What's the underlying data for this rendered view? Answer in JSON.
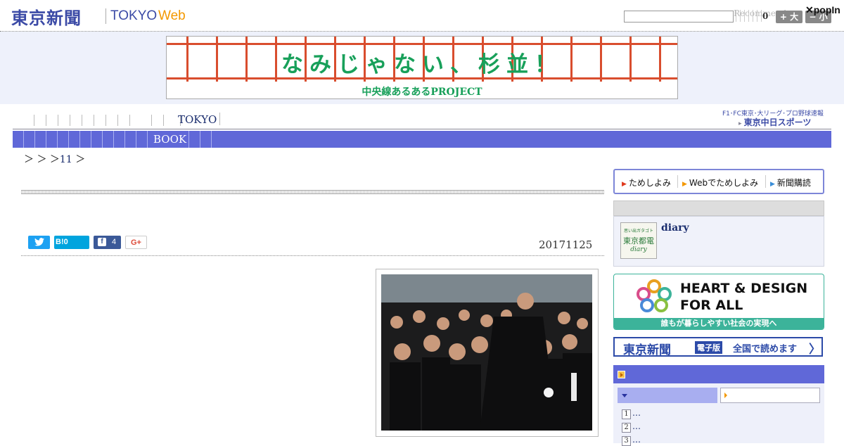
{
  "header": {
    "logo_jp": "東京新聞",
    "logo_tokyo": "TOKYO",
    "logo_web": "Web",
    "search_placeholder": "",
    "popin_label": "Recommend",
    "count": "0",
    "font_big_label": "+ 大",
    "font_small_label": "− 小",
    "popin_logo": "popIn"
  },
  "ad_banner": {
    "title": "なみじゃない、杉並！",
    "subtitle": "中央線あるあるPROJECT"
  },
  "nav": {
    "primary_active": "TOKYO",
    "chunichi_line1": "F1･FC東京･大リーグ･プロ野球速報",
    "chunichi_line2": "東京中日スポーツ",
    "secondary_active": "BOOK"
  },
  "breadcrumb": {
    "sep1": "＞",
    "sep2": "＞",
    "sep3": "＞",
    "link": "11",
    "sep4": "＞"
  },
  "article": {
    "share_twitter": "",
    "share_hatena": "B!",
    "share_hatena_count": "0",
    "share_facebook_icon": "f",
    "share_facebook_count": "4",
    "share_gplus": "G+",
    "date": "20171125"
  },
  "sidebar": {
    "tameshi": [
      "ためしよみ",
      "Webでためしよみ",
      "新聞購読"
    ],
    "diary_thumb_line1": "思い出ガタゴト",
    "diary_thumb_line2": "東京都電",
    "diary_thumb_line3": "diary",
    "diary_link": "diary",
    "hd_line1": "HEART & DESIGN",
    "hd_line2": "FOR ALL",
    "hd_bar": "誰もが暮らしやすい社会の実現へ",
    "denshi_logo": "東京新聞",
    "denshi_tag": "電子版",
    "denshi_text": "全国で読めます",
    "denshi_arrow": "〉",
    "ranking_items": [
      "…",
      "…",
      "…"
    ]
  },
  "colors": {
    "brand_blue": "#3b4aa6",
    "nav_blue": "#6068d8",
    "web_orange": "#f39800",
    "ad_green": "#18a05a",
    "ad_red": "#d94d2e",
    "hd_teal": "#3cb39a"
  }
}
